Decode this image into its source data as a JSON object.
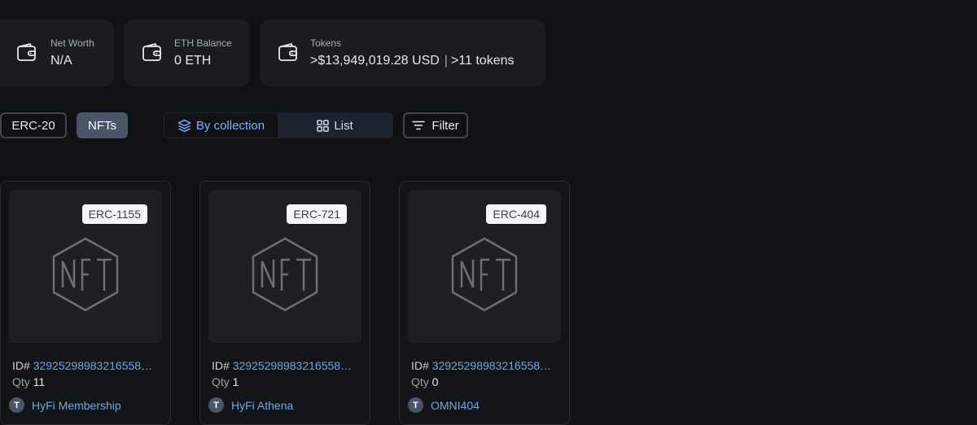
{
  "stats": [
    {
      "label": "Net Worth",
      "value": "N/A"
    },
    {
      "label": "ETH Balance",
      "value": "0 ETH"
    },
    {
      "label": "Tokens",
      "value": ">$13,949,019.28 USD",
      "extra": ">11 tokens"
    }
  ],
  "token_tabs": {
    "erc20": "ERC-20",
    "nfts": "NFTs"
  },
  "view_toggle": {
    "by_collection": "By collection",
    "list": "List"
  },
  "filter_label": "Filter",
  "nfts": [
    {
      "standard": "ERC-1155",
      "id_prefix": "ID#",
      "id": "32925298983216558…",
      "qty_label": "Qty",
      "qty": "11",
      "collection": "HyFi Membership",
      "collection_icon": "T"
    },
    {
      "standard": "ERC-721",
      "id_prefix": "ID#",
      "id": "32925298983216558…",
      "qty_label": "Qty",
      "qty": "1",
      "collection": "HyFi Athena",
      "collection_icon": "T"
    },
    {
      "standard": "ERC-404",
      "id_prefix": "ID#",
      "id": "32925298983216558…",
      "qty_label": "Qty",
      "qty": "0",
      "collection": "OMNI404",
      "collection_icon": "T"
    }
  ]
}
